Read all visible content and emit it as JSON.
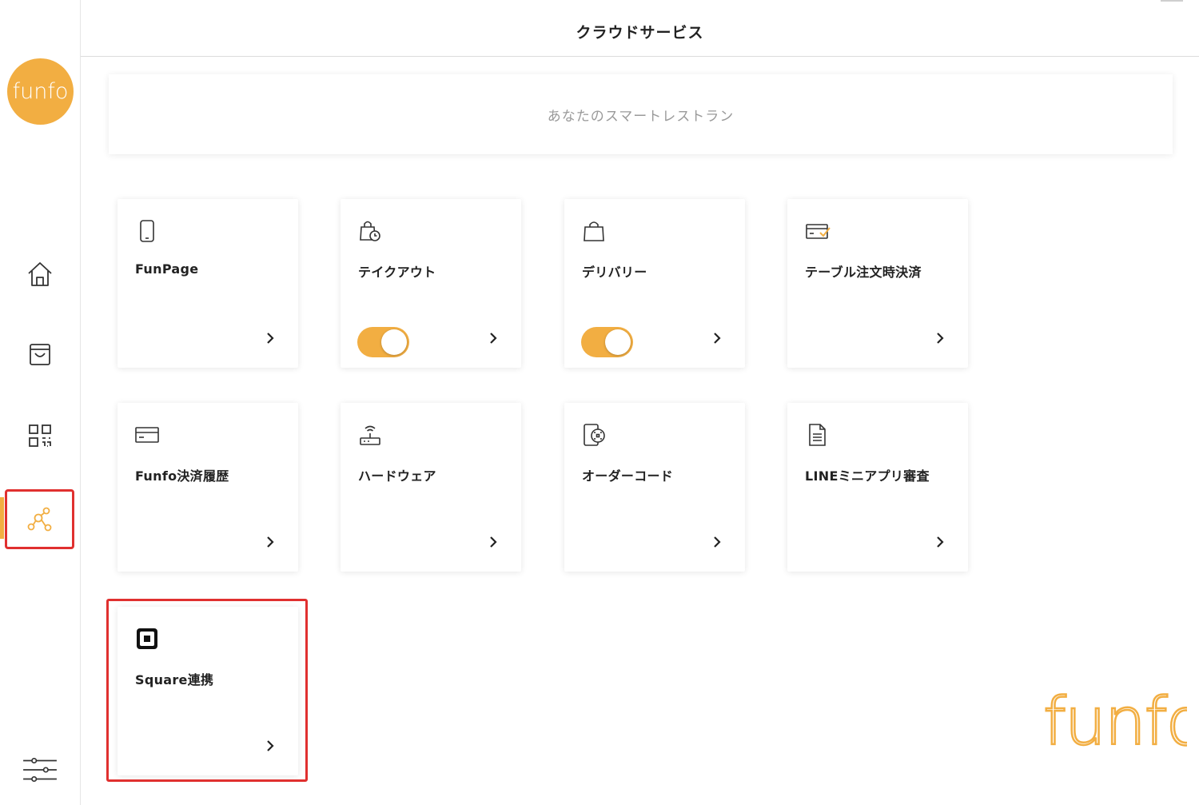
{
  "header": {
    "title": "クラウドサービス"
  },
  "sidebar": {
    "logo_text": "funfo",
    "items": [
      {
        "name": "home",
        "icon": "home-icon"
      },
      {
        "name": "orders",
        "icon": "inbox-icon"
      },
      {
        "name": "qr",
        "icon": "qr-code-icon"
      },
      {
        "name": "cloud",
        "icon": "network-icon",
        "active": true
      },
      {
        "name": "settings",
        "icon": "sliders-icon"
      }
    ]
  },
  "banner": {
    "text": "あなたのスマートレストラン"
  },
  "cards": [
    {
      "label": "FunPage",
      "icon": "smartphone-icon",
      "toggle": null
    },
    {
      "label": "テイクアウト",
      "icon": "bag-clock-icon",
      "toggle": true
    },
    {
      "label": "デリバリー",
      "icon": "shopping-bag-icon",
      "toggle": true
    },
    {
      "label": "テーブル注文時決済",
      "icon": "card-check-icon",
      "toggle": null
    },
    {
      "label": "Funfo決済履歴",
      "icon": "credit-card-icon",
      "toggle": null
    },
    {
      "label": "ハードウェア",
      "icon": "router-icon",
      "toggle": null
    },
    {
      "label": "オーダーコード",
      "icon": "order-code-icon",
      "toggle": null
    },
    {
      "label": "LINEミニアプリ審査",
      "icon": "document-icon",
      "toggle": null
    },
    {
      "label": "Square連携",
      "icon": "square-logo-icon",
      "toggle": null
    }
  ],
  "brand": {
    "text": "funfo"
  },
  "colors": {
    "accent": "#f2ae42",
    "highlight": "#e0302f"
  }
}
